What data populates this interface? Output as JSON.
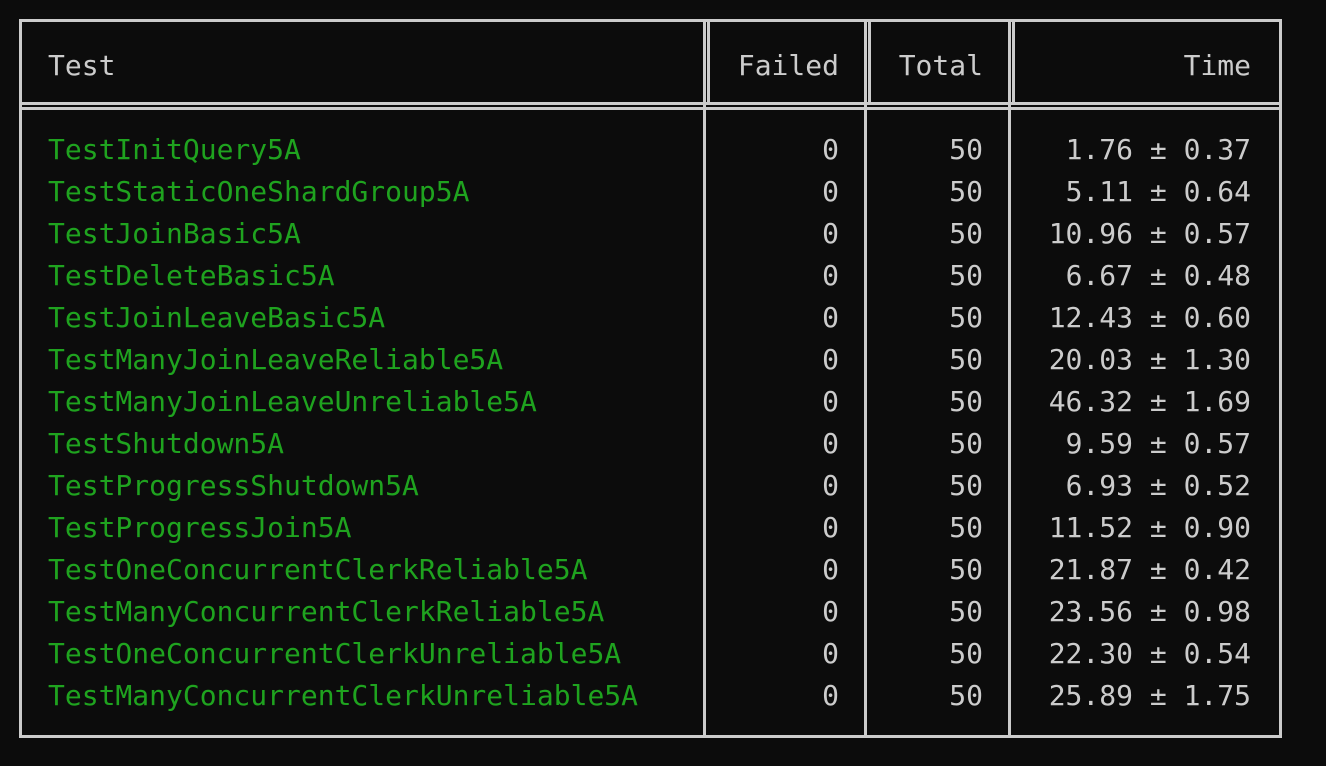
{
  "table": {
    "headers": {
      "test": "Test",
      "failed": "Failed",
      "total": "Total",
      "time": "Time"
    },
    "rows": [
      {
        "name": "TestInitQuery5A",
        "failed": "0",
        "total": "50",
        "time": "1.76 ± 0.37"
      },
      {
        "name": "TestStaticOneShardGroup5A",
        "failed": "0",
        "total": "50",
        "time": "5.11 ± 0.64"
      },
      {
        "name": "TestJoinBasic5A",
        "failed": "0",
        "total": "50",
        "time": "10.96 ± 0.57"
      },
      {
        "name": "TestDeleteBasic5A",
        "failed": "0",
        "total": "50",
        "time": "6.67 ± 0.48"
      },
      {
        "name": "TestJoinLeaveBasic5A",
        "failed": "0",
        "total": "50",
        "time": "12.43 ± 0.60"
      },
      {
        "name": "TestManyJoinLeaveReliable5A",
        "failed": "0",
        "total": "50",
        "time": "20.03 ± 1.30"
      },
      {
        "name": "TestManyJoinLeaveUnreliable5A",
        "failed": "0",
        "total": "50",
        "time": "46.32 ± 1.69"
      },
      {
        "name": "TestShutdown5A",
        "failed": "0",
        "total": "50",
        "time": "9.59 ± 0.57"
      },
      {
        "name": "TestProgressShutdown5A",
        "failed": "0",
        "total": "50",
        "time": "6.93 ± 0.52"
      },
      {
        "name": "TestProgressJoin5A",
        "failed": "0",
        "total": "50",
        "time": "11.52 ± 0.90"
      },
      {
        "name": "TestOneConcurrentClerkReliable5A",
        "failed": "0",
        "total": "50",
        "time": "21.87 ± 0.42"
      },
      {
        "name": "TestManyConcurrentClerkReliable5A",
        "failed": "0",
        "total": "50",
        "time": "23.56 ± 0.98"
      },
      {
        "name": "TestOneConcurrentClerkUnreliable5A",
        "failed": "0",
        "total": "50",
        "time": "22.30 ± 0.54"
      },
      {
        "name": "TestManyConcurrentClerkUnreliable5A",
        "failed": "0",
        "total": "50",
        "time": "25.89 ± 1.75"
      }
    ]
  },
  "colors": {
    "background": "#0c0c0c",
    "text": "#cccccc",
    "test_name": "#1fa31f",
    "border": "#cccccc"
  }
}
